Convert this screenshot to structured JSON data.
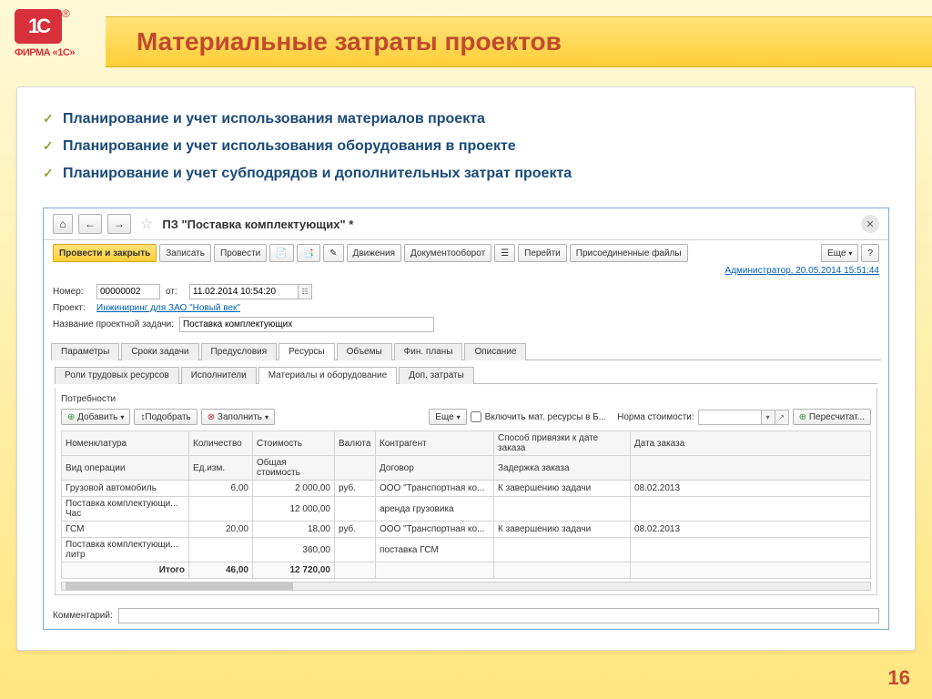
{
  "page": {
    "title": "Материальные затраты проектов",
    "brand_line": "ФИРМА «1С»",
    "page_number": "16"
  },
  "bullets": [
    "Планирование и учет использования материалов проекта",
    "Планирование и учет использования оборудования в проекте",
    "Планирование и учет субподрядов и дополнительных затрат проекта"
  ],
  "window": {
    "title": "ПЗ \"Поставка комплектующих\" *",
    "toolbar": {
      "primary": "Провести и закрыть",
      "save": "Записать",
      "post": "Провести",
      "movements": "Движения",
      "docflow": "Документооборот",
      "goto": "Перейти",
      "attached": "Присоединенные файлы",
      "more": "Еще",
      "help": "?"
    },
    "meta_link": "Администратор, 20.05.2014 15:51:44",
    "form": {
      "number_label": "Номер:",
      "number_value": "00000002",
      "date_label": "от:",
      "date_value": "11.02.2014 10:54:20",
      "project_label": "Проект:",
      "project_value": "Инжиниринг для ЗАО \"Новый век\"",
      "task_label": "Название проектной задачи:",
      "task_value": "Поставка комплектующих"
    },
    "tabs1": [
      "Параметры",
      "Сроки задачи",
      "Предусловия",
      "Ресурсы",
      "Объемы",
      "Фин. планы",
      "Описание"
    ],
    "tabs1_active": 3,
    "tabs2": [
      "Роли трудовых ресурсов",
      "Исполнители",
      "Материалы и оборудование",
      "Доп. затраты"
    ],
    "tabs2_active": 2,
    "section_title": "Потребности",
    "sub_toolbar": {
      "add": "Добавить",
      "pick": "Подобрать",
      "fill": "Заполнить",
      "more": "Еще",
      "include_label": "Включить мат. ресурсы в Б...",
      "rate_label": "Норма стоимости:",
      "recalc": "Пересчитат..."
    },
    "grid": {
      "headers1": [
        "Номенклатура",
        "Количество",
        "Стоимость",
        "Валюта",
        "Контрагент",
        "Способ привязки к дате заказа",
        "Дата заказа"
      ],
      "headers2": [
        "Вид операции",
        "Ед.изм.",
        "Общая стоимость",
        "",
        "Договор",
        "Задержка заказа",
        ""
      ],
      "rows": [
        {
          "c": [
            "Грузовой автомобиль",
            "6,00",
            "2 000,00",
            "руб.",
            "ООО \"Транспортная ко...",
            "К завершению задачи",
            "08.02.2013"
          ]
        },
        {
          "c": [
            "Поставка комплектующи...  Час",
            "",
            "12 000,00",
            "",
            "аренда грузовика",
            "",
            ""
          ]
        },
        {
          "c": [
            "ГСМ",
            "20,00",
            "18,00",
            "руб.",
            "ООО \"Транспортная ко...",
            "К завершению задачи",
            "08.02.2013"
          ]
        },
        {
          "c": [
            "Поставка комплектующи...  литр",
            "",
            "360,00",
            "",
            "поставка ГСМ",
            "",
            ""
          ]
        }
      ],
      "total": [
        "Итого",
        "46,00",
        "12 720,00",
        "",
        "",
        "",
        ""
      ]
    },
    "comment_label": "Комментарий:"
  }
}
